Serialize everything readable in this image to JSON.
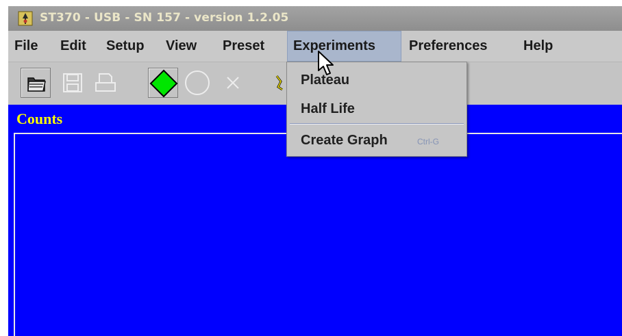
{
  "window": {
    "title": "ST370 - USB - SN 157 - version 1.2.05"
  },
  "menubar": {
    "items": [
      "File",
      "Edit",
      "Setup",
      "View",
      "Preset",
      "Experiments",
      "Preferences",
      "Help"
    ]
  },
  "toolbar": {
    "icons": [
      "open-folder-icon",
      "save-icon",
      "print-icon",
      "start-diamond-icon",
      "stop-circle-icon",
      "clear-x-icon",
      "radiation-icon"
    ]
  },
  "counts": {
    "label": "Counts"
  },
  "experiments_menu": {
    "items": [
      {
        "label": "Plateau",
        "shortcut": ""
      },
      {
        "label": "Half Life",
        "shortcut": ""
      },
      {
        "label": "Create Graph",
        "shortcut": "Ctrl-G"
      }
    ]
  },
  "colors": {
    "counts_background": "#0000ff",
    "counts_label": "#ffff00",
    "menu_highlight": "#a9b6cc",
    "start_green": "#00e600"
  }
}
